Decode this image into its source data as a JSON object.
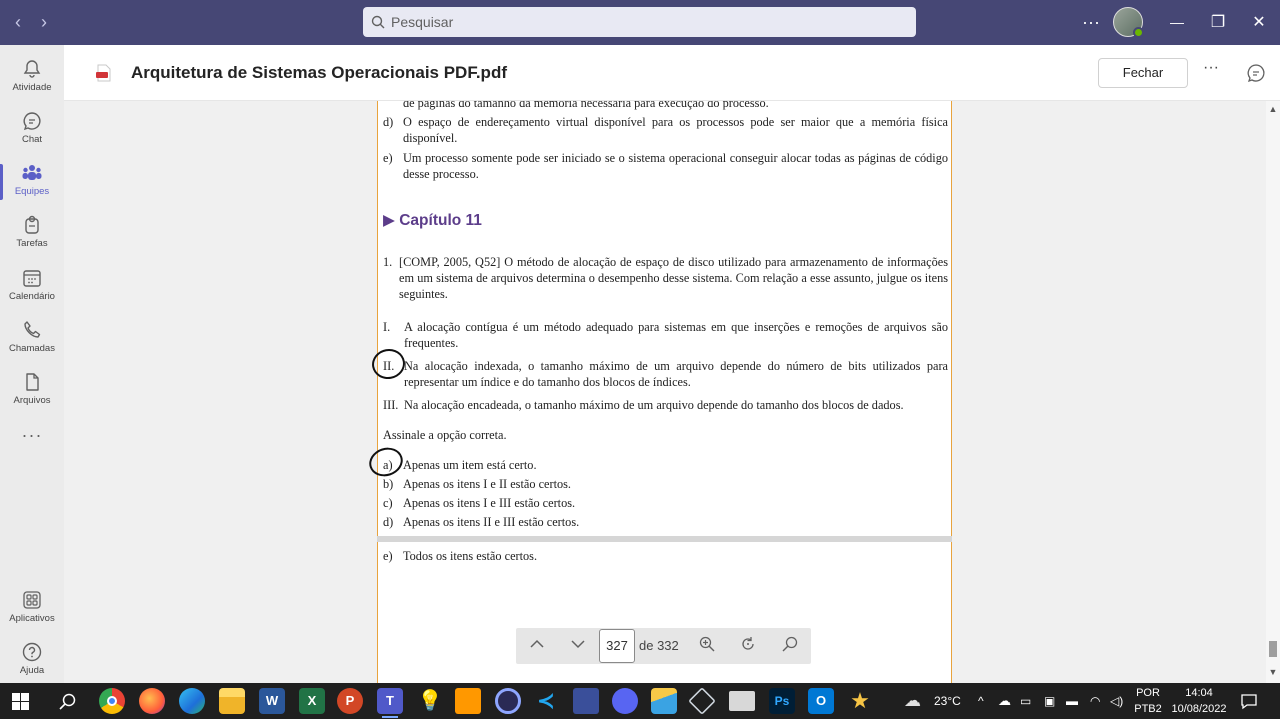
{
  "titlebar": {
    "search_placeholder": "Pesquisar",
    "more": "···",
    "minimize": "—",
    "restore": "❐",
    "close": "✕"
  },
  "rail": [
    {
      "label": "Atividade",
      "icon": "bell-icon"
    },
    {
      "label": "Chat",
      "icon": "chat-icon"
    },
    {
      "label": "Equipes",
      "icon": "teams-icon",
      "active": true
    },
    {
      "label": "Tarefas",
      "icon": "tasks-icon"
    },
    {
      "label": "Calendário",
      "icon": "calendar-icon"
    },
    {
      "label": "Chamadas",
      "icon": "phone-icon"
    },
    {
      "label": "Arquivos",
      "icon": "file-icon"
    },
    {
      "label": "Aplicativos",
      "icon": "apps-icon"
    },
    {
      "label": "Ajuda",
      "icon": "help-icon"
    }
  ],
  "rail_more": "···",
  "header": {
    "title": "Arquitetura de Sistemas Operacionais PDF.pdf",
    "close_label": "Fechar",
    "more": "···"
  },
  "page": {
    "line_partial": "de páginas do tamanho da memória necessária para execução do processo.",
    "prev_options": [
      {
        "marker": "d)",
        "text": "O espaço de endereçamento virtual disponível para os processos pode ser maior que a memória física disponível."
      },
      {
        "marker": "e)",
        "text": "Um processo somente pode ser iniciado se o sistema operacional conseguir alocar todas as páginas de código desse processo."
      }
    ],
    "chapter": "▶ Capítulo 11",
    "question_number": "1.",
    "question_text": "[COMP, 2005, Q52] O método de alocação de espaço de disco utilizado para armazenamento de informações em um sistema de arquivos determina o desempenho desse sistema. Com relação a esse assunto, julgue os itens seguintes.",
    "items": [
      {
        "marker": "I.",
        "text": "A alocação contígua é um método adequado para sistemas em que inserções e remoções de arquivos são frequentes."
      },
      {
        "marker": "II.",
        "text": "Na alocação indexada, o tamanho máximo de um arquivo depende do número de bits utilizados para representar um índice e do tamanho dos blocos de índices."
      },
      {
        "marker": "III.",
        "text": "Na alocação encadeada, o tamanho máximo de um arquivo depende do tamanho dos blocos de dados."
      }
    ],
    "instruction": "Assinale a opção correta.",
    "options": [
      {
        "marker": "a)",
        "text": "Apenas um item está certo."
      },
      {
        "marker": "b)",
        "text": "Apenas os itens I e II estão certos."
      },
      {
        "marker": "c)",
        "text": "Apenas os itens I e III estão certos."
      },
      {
        "marker": "d)",
        "text": "Apenas os itens II e III estão certos."
      }
    ],
    "next_option": {
      "marker": "e)",
      "text": "Todos os itens estão certos."
    }
  },
  "pager": {
    "current_page": "327",
    "total": "de 332"
  },
  "taskbar": {
    "weather": "23°C",
    "language_1": "POR",
    "language_2": "PTB2",
    "time": "14:04",
    "date": "10/08/2022",
    "apps": [
      "windows-start",
      "search",
      "chrome",
      "firefox",
      "edge",
      "file-explorer",
      "word",
      "excel",
      "powerpoint",
      "teams",
      "tips-bulb",
      "sublime",
      "app-ring",
      "vscode",
      "visual-studio",
      "discord",
      "app-stripes",
      "virtualbox",
      "app-window",
      "photoshop",
      "outlook",
      "app-star"
    ]
  },
  "colors": {
    "titlebar": "#464775",
    "accent": "#5b5fc7",
    "chapter": "#5c3d8a",
    "page_border": "#e8a33d"
  }
}
